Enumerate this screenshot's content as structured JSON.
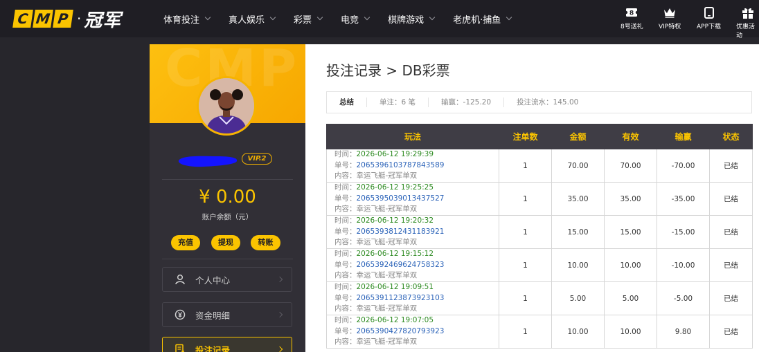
{
  "brand": {
    "letters": [
      "C",
      "M",
      "P"
    ],
    "dot": "·",
    "cn": "冠军"
  },
  "nav": [
    {
      "label": "体育投注"
    },
    {
      "label": "真人娱乐"
    },
    {
      "label": "彩票"
    },
    {
      "label": "电竞"
    },
    {
      "label": "棋牌游戏"
    },
    {
      "label": "老虎机·捕鱼"
    }
  ],
  "quick": [
    {
      "label": "8号送礼",
      "icon": "gift-ticket-icon"
    },
    {
      "label": "VIP特权",
      "icon": "crown-icon"
    },
    {
      "label": "APP下载",
      "icon": "phone-icon"
    },
    {
      "label": "优惠活动",
      "icon": "gift-box-icon"
    }
  ],
  "sidebar": {
    "watermark": "CMP",
    "vip": "VIP.2",
    "balance": "¥ 0.00",
    "balance_label": "账户余额（元）",
    "actions": {
      "deposit": "充值",
      "withdraw": "提现",
      "transfer": "转账"
    },
    "menu": [
      {
        "label": "个人中心",
        "icon": "user-icon"
      },
      {
        "label": "资金明细",
        "icon": "yuan-coin-icon"
      },
      {
        "label": "投注记录",
        "icon": "bet-record-icon"
      }
    ]
  },
  "main": {
    "title": "投注记录 > DB彩票",
    "summary": {
      "total": "总结",
      "bets": "单注：6 笔",
      "profit": "输赢：-125.20",
      "turnover": "投注流水：145.00"
    },
    "columns": [
      "玩法",
      "注单数",
      "金额",
      "有效",
      "输赢",
      "状态"
    ],
    "labels": {
      "time": "时间：",
      "order": "单号：",
      "content": "内容："
    },
    "rows": [
      {
        "time": "2026-06-12 19:29:39",
        "order": "2065396103787843589",
        "content": "幸运飞艇-冠军单双",
        "count": "1",
        "amount": "70.00",
        "valid": "70.00",
        "winloss": "-70.00",
        "status": "已结"
      },
      {
        "time": "2026-06-12 19:25:25",
        "order": "2065395039013437527",
        "content": "幸运飞艇-冠军单双",
        "count": "1",
        "amount": "35.00",
        "valid": "35.00",
        "winloss": "-35.00",
        "status": "已结"
      },
      {
        "time": "2026-06-12 19:20:32",
        "order": "2065393812431183921",
        "content": "幸运飞艇-冠军单双",
        "count": "1",
        "amount": "15.00",
        "valid": "15.00",
        "winloss": "-15.00",
        "status": "已结"
      },
      {
        "time": "2026-06-12 19:15:12",
        "order": "2065392469624758323",
        "content": "幸运飞艇-冠军单双",
        "count": "1",
        "amount": "10.00",
        "valid": "10.00",
        "winloss": "-10.00",
        "status": "已结"
      },
      {
        "time": "2026-06-12 19:09:51",
        "order": "2065391123873923103",
        "content": "幸运飞艇-冠军单双",
        "count": "1",
        "amount": "5.00",
        "valid": "5.00",
        "winloss": "-5.00",
        "status": "已结"
      },
      {
        "time": "2026-06-12 19:07:05",
        "order": "2065390427820793923",
        "content": "幸运飞艇-冠军单双",
        "count": "1",
        "amount": "10.00",
        "valid": "10.00",
        "winloss": "9.80",
        "status": "已结"
      }
    ]
  },
  "colors": {
    "accent": "#fbc400",
    "header_bg": "#1f1e24",
    "loss": "#e22020",
    "win": "#2e8b22",
    "order_link": "#2a62b8"
  }
}
